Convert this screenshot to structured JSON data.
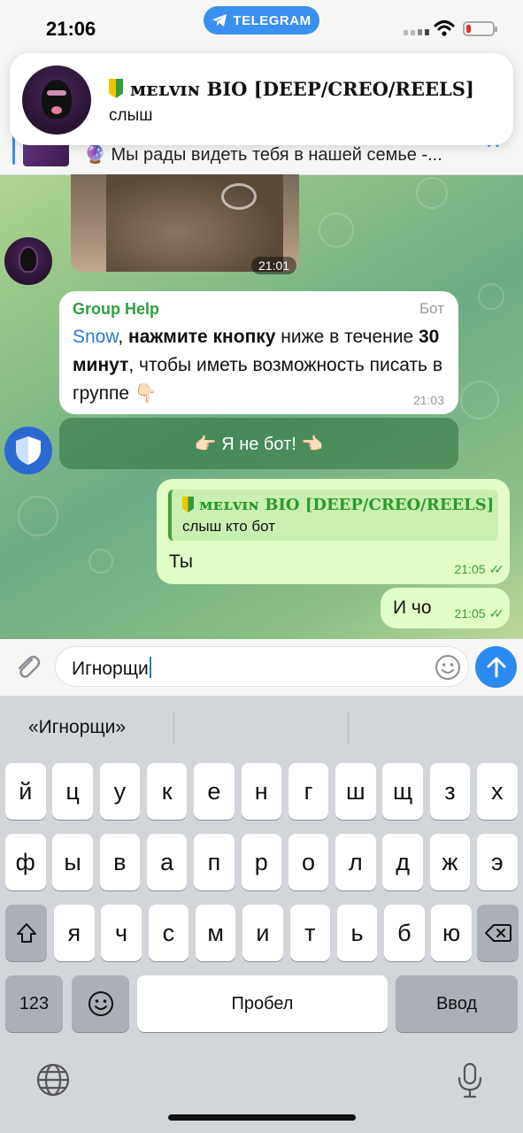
{
  "status_bar": {
    "time": "21:06",
    "app_pill": "TELEGRAM"
  },
  "notification": {
    "sender": "ᴍᴇʟᴠɪɴ BIO [DEEP/CREO/REELS]",
    "body": "слыш"
  },
  "pinned": {
    "text": "🔮 Мы рады видеть тебя в нашей семье -..."
  },
  "photo_message": {
    "time": "21:01"
  },
  "bot_message": {
    "sender": "Group Help",
    "tag": "Бот",
    "mention": "Snow",
    "text_a": ", ",
    "bold_a": "нажмите кнопку",
    "text_b": " ниже в течение ",
    "bold_b": "30 минут",
    "text_c": ", чтобы иметь возможность писать в группе 👇🏻",
    "time": "21:03"
  },
  "inline_button": {
    "label": "👉🏻 Я не бот! 👈🏻"
  },
  "outgoing": [
    {
      "reply_name": "ᴍᴇʟᴠɪɴ BIO [DEEP/CREO/REELS]",
      "reply_text": "слыш кто бот",
      "text": "Ты",
      "time": "21:05"
    },
    {
      "text": "И чо",
      "time": "21:05"
    }
  ],
  "composer": {
    "value": "Игнорщи"
  },
  "keyboard": {
    "suggestion": "«Игнорщи»",
    "row1": [
      "й",
      "ц",
      "у",
      "к",
      "е",
      "н",
      "г",
      "ш",
      "щ",
      "з",
      "х"
    ],
    "row2": [
      "ф",
      "ы",
      "в",
      "а",
      "п",
      "р",
      "о",
      "л",
      "д",
      "ж",
      "э"
    ],
    "row3": [
      "я",
      "ч",
      "с",
      "м",
      "и",
      "т",
      "ь",
      "б",
      "ю"
    ],
    "numbers_key": "123",
    "space_key": "Пробел",
    "return_key": "Ввод"
  },
  "colors": {
    "accent": "#2a8af0",
    "outgoing_bubble": "#e1fec6",
    "bot_name": "#2ea043"
  }
}
